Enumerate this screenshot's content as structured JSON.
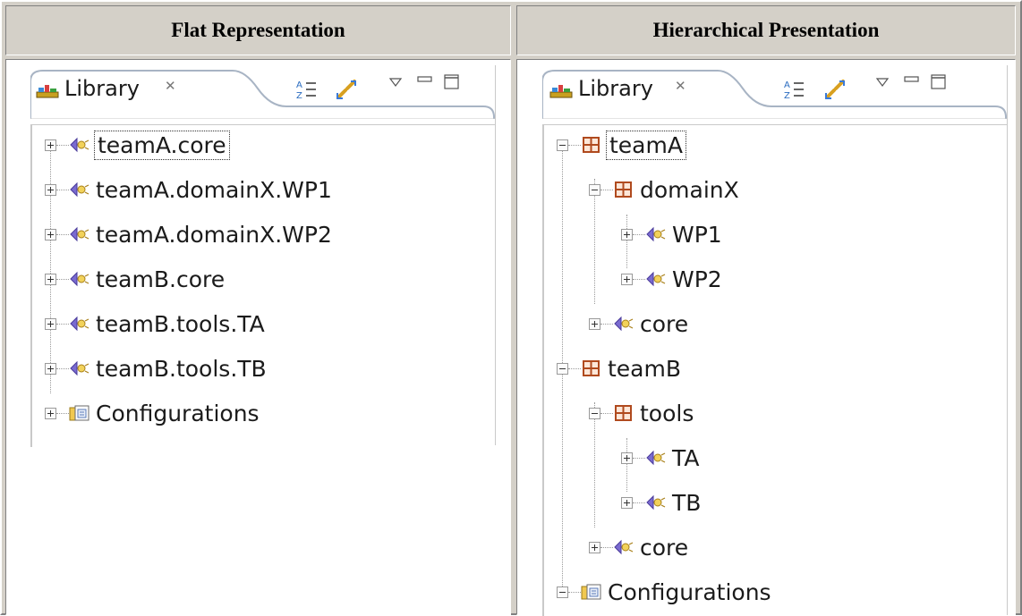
{
  "headers": {
    "flat": "Flat Representation",
    "hier": "Hierarchical Presentation"
  },
  "view_title": "Library",
  "close_glyph": "✕",
  "flat_tree": [
    {
      "label": "teamA.core",
      "icon": "package-icon",
      "selected": true
    },
    {
      "label": "teamA.domainX.WP1",
      "icon": "package-icon"
    },
    {
      "label": "teamA.domainX.WP2",
      "icon": "package-icon"
    },
    {
      "label": "teamB.core",
      "icon": "package-icon"
    },
    {
      "label": "teamB.tools.TA",
      "icon": "package-icon"
    },
    {
      "label": "teamB.tools.TB",
      "icon": "package-icon"
    },
    {
      "label": "Configurations",
      "icon": "configurations-folder-icon"
    }
  ],
  "hier_tree": [
    {
      "label": "teamA",
      "icon": "namespace-icon",
      "expanded": true,
      "selected": true
    },
    {
      "label": "domainX",
      "icon": "namespace-icon",
      "expanded": true
    },
    {
      "label": "WP1",
      "icon": "package-icon"
    },
    {
      "label": "WP2",
      "icon": "package-icon"
    },
    {
      "label": "core",
      "icon": "package-icon"
    },
    {
      "label": "teamB",
      "icon": "namespace-icon",
      "expanded": true
    },
    {
      "label": "tools",
      "icon": "namespace-icon",
      "expanded": true
    },
    {
      "label": "TA",
      "icon": "package-icon"
    },
    {
      "label": "TB",
      "icon": "package-icon"
    },
    {
      "label": "core",
      "icon": "package-icon"
    },
    {
      "label": "Configurations",
      "icon": "configurations-folder-icon",
      "expanded": true
    }
  ],
  "toolbar_icons": [
    "sort-alpha-icon",
    "link-with-editor-icon",
    "view-menu-icon",
    "minimize-icon",
    "maximize-icon"
  ],
  "colors": {
    "frame": "#d4d0c8",
    "package_icon": "#7a6bd0",
    "namespace_icon": "#b04a1e",
    "library_icon": "#c8a020"
  }
}
